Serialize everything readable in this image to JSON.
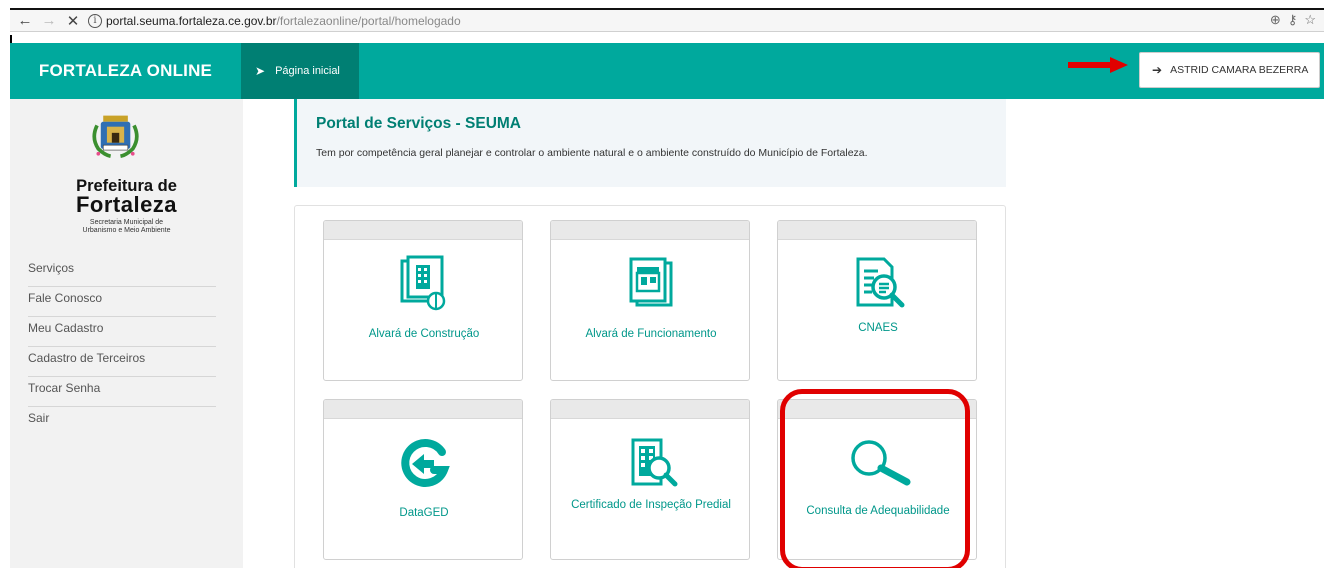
{
  "browser": {
    "back_icon": "back-arrow-icon",
    "forward_icon": "forward-arrow-icon",
    "stop_icon": "close-icon",
    "url_host": "portal.seuma.fortaleza.ce.gov.br",
    "url_path": "/fortalezaonline/portal/homelogado"
  },
  "header": {
    "brand": "FORTALEZA ONLINE",
    "home_tab": "Página inicial",
    "user_button": "ASTRID CAMARA BEZERRA"
  },
  "sidebar": {
    "logo_line1": "Prefeitura de",
    "logo_line2": "Fortaleza",
    "logo_line3": "Secretaria Municipal de",
    "logo_line4": "Urbanismo e Meio Ambiente",
    "items": [
      {
        "label": "Serviços"
      },
      {
        "label": "Fale Conosco"
      },
      {
        "label": "Meu Cadastro"
      },
      {
        "label": "Cadastro de Terceiros"
      },
      {
        "label": "Trocar Senha"
      },
      {
        "label": "Sair"
      }
    ]
  },
  "banner": {
    "title": "Portal de Serviços - SEUMA",
    "description": "Tem por competência geral planejar e controlar o ambiente natural e o ambiente construído do Município de Fortaleza."
  },
  "cards": [
    {
      "label": "Alvará de Construção",
      "icon": "building-document-icon"
    },
    {
      "label": "Alvará de Funcionamento",
      "icon": "storefront-document-icon"
    },
    {
      "label": "CNAES",
      "icon": "document-search-icon"
    },
    {
      "label": "DataGED",
      "icon": "datagged-logo-icon"
    },
    {
      "label": "Certificado de Inspeção Predial",
      "icon": "building-search-icon"
    },
    {
      "label": "Consulta de Adequabilidade",
      "icon": "magnifier-icon"
    }
  ],
  "colors": {
    "teal": "#00a99d",
    "teal_dark": "#007f73",
    "highlight_red": "#e00000"
  }
}
